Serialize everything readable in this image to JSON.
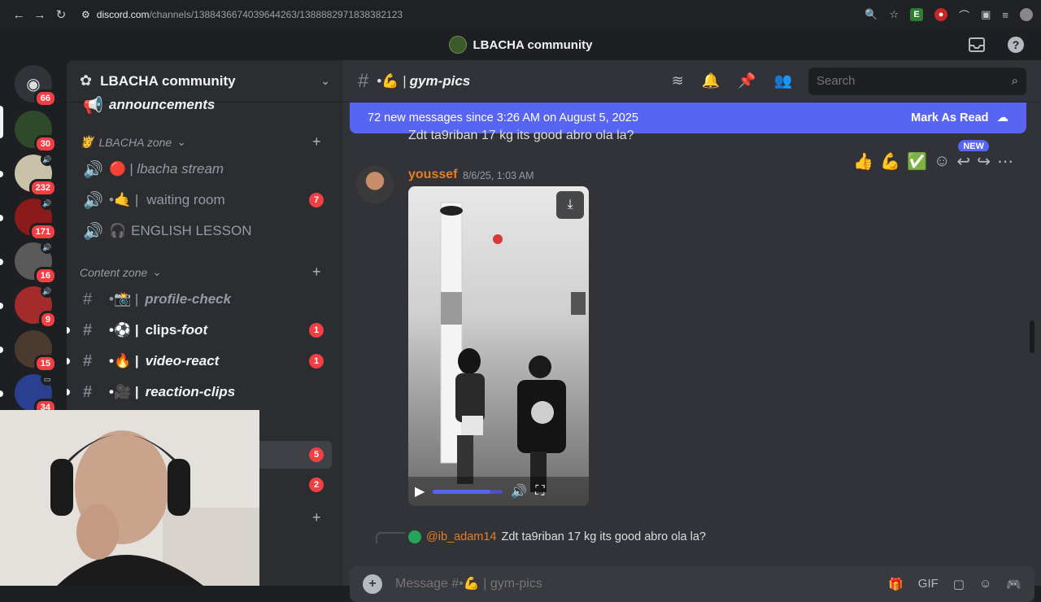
{
  "browser": {
    "url_host": "discord.com",
    "url_path": "/channels/1388436674039644263/1388882971838382123"
  },
  "window": {
    "title": "LBACHA community"
  },
  "guilds": [
    {
      "badge": "66"
    },
    {
      "badge": "30"
    },
    {
      "badge": "232"
    },
    {
      "badge": "171"
    },
    {
      "badge": "16"
    },
    {
      "badge": "9"
    },
    {
      "badge": "15"
    },
    {
      "badge": "34"
    }
  ],
  "sidebar": {
    "server_name": "LBACHA community",
    "categories": {
      "zone": "LBACHA zone",
      "content": "Content zone"
    },
    "channels": {
      "announcements": "announcements",
      "lbacha_stream": "lbacha stream",
      "waiting_room": "waiting room",
      "english_lesson": "ENGLISH LESSON",
      "profile_check": "profile-check",
      "clips_foot_a": "clips-",
      "clips_foot_b": "foot",
      "video_react": "video-react",
      "reaction_clips": "reaction-clips"
    },
    "badges": {
      "waiting_room": "7",
      "clips_foot": "1",
      "video_react": "1",
      "hidden1": "5",
      "hidden2": "2"
    }
  },
  "channel": {
    "name": "gym-pics",
    "search_placeholder": "Search"
  },
  "banner": {
    "text": "72 new messages since 3:26 AM on August 5, 2025",
    "mark_read": "Mark As Read"
  },
  "messages": {
    "prev_text": "Zdt ta9riban 17 kg its good abro ola la?",
    "new_tag": "NEW",
    "author": "youssef",
    "timestamp": "8/6/25, 1:03 AM",
    "reply_mention": "@ib_adam14",
    "reply_text": "Zdt ta9riban 17 kg its good abro ola la?"
  },
  "video": {
    "progress": 0.82
  },
  "composer": {
    "placeholder": "Message #•💪 | gym-pics"
  },
  "colors": {
    "blurple": "#5865f2",
    "red_badge": "#f23f43",
    "author": "#e67e22"
  }
}
